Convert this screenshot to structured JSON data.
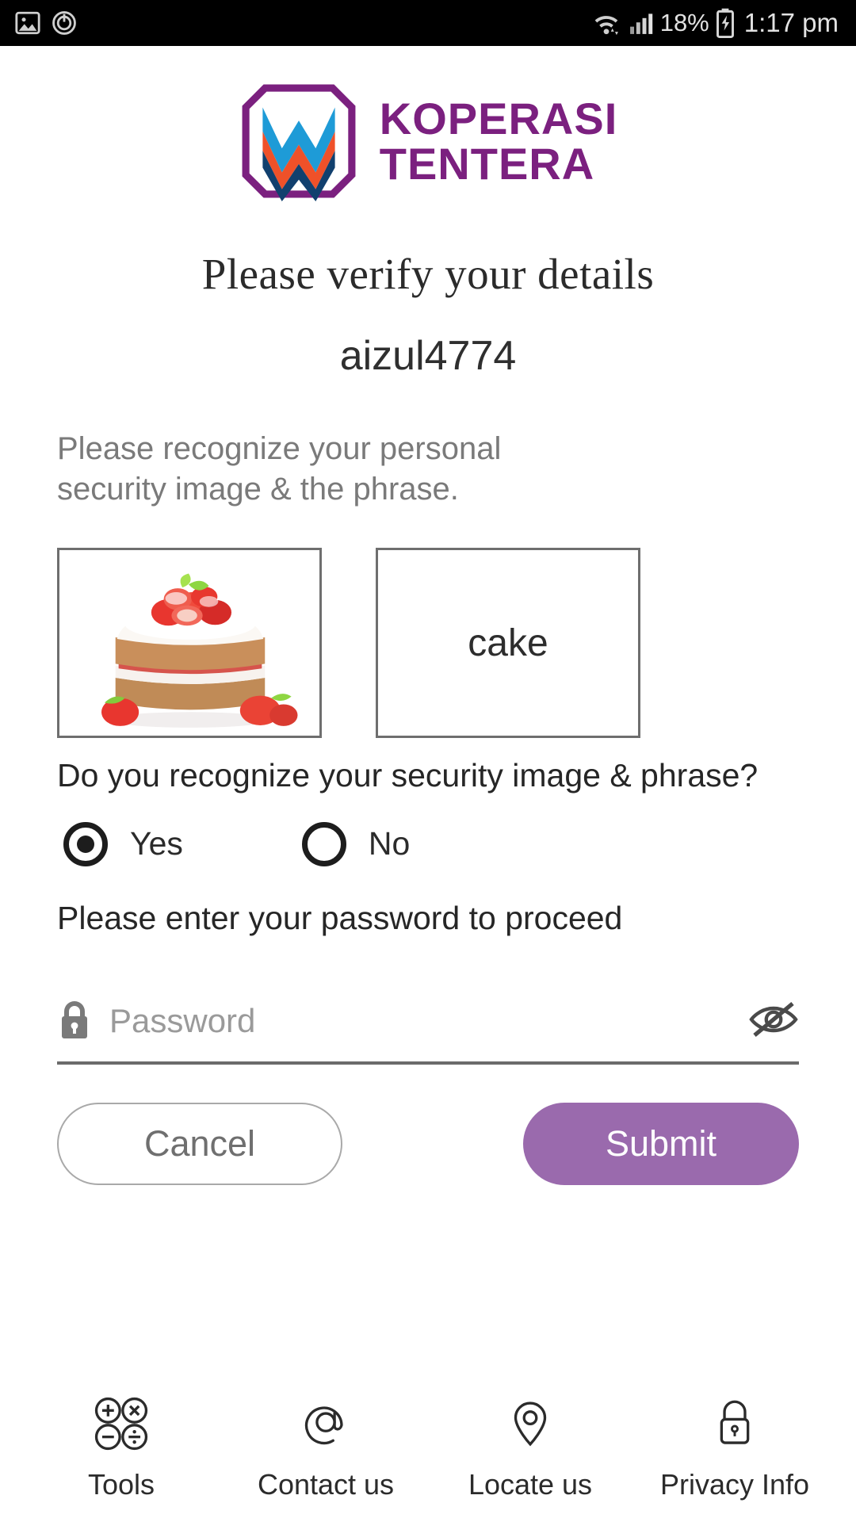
{
  "statusbar": {
    "left_icons": [
      "image-icon",
      "power-sync-icon"
    ],
    "wifi_icon": "wifi-icon",
    "signal_icon": "cellular-signal-icon",
    "battery_percent": "18%",
    "battery_icon": "battery-charging-icon",
    "time": "1:17 pm"
  },
  "brand": {
    "logo_icon": "koperasi-tentera-logo",
    "line1": "KOPERASI",
    "line2": "TENTERA",
    "purple": "#7b207f",
    "chevron_blue": "#1e9bd7",
    "chevron_orange": "#ef5129",
    "chevron_navy": "#11406e"
  },
  "main": {
    "title": "Please verify your details",
    "username": "aizul4774",
    "instruction": "Please recognize your personal security image & the phrase.",
    "security_image_alt": "strawberry-layer-cake",
    "security_phrase": "cake",
    "recognize_question": "Do you recognize your security image & phrase?",
    "radios": [
      {
        "label": "Yes",
        "value": "yes",
        "selected": true
      },
      {
        "label": "No",
        "value": "no",
        "selected": false
      }
    ],
    "password_prompt": "Please enter your password to proceed",
    "password": {
      "placeholder": "Password",
      "value": "",
      "lock_icon": "lock-icon",
      "toggle_icon": "eye-off-icon"
    },
    "buttons": {
      "cancel": "Cancel",
      "submit": "Submit",
      "submit_color": "#9a6aad"
    }
  },
  "footer": {
    "items": [
      {
        "label": "Tools",
        "icon": "calculator-icon"
      },
      {
        "label": "Contact us",
        "icon": "at-sign-icon"
      },
      {
        "label": "Locate us",
        "icon": "map-pin-icon"
      },
      {
        "label": "Privacy Info",
        "icon": "padlock-icon"
      }
    ]
  }
}
